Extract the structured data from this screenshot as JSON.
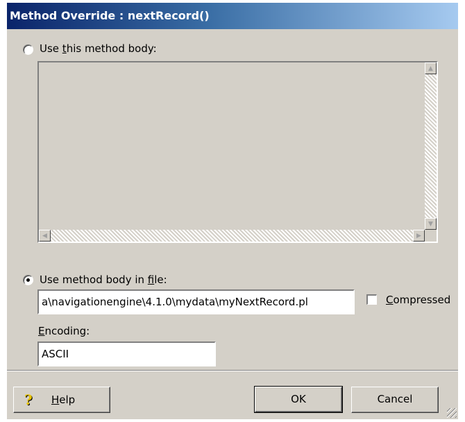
{
  "window": {
    "title": "Method Override : nextRecord()"
  },
  "option_body": {
    "label_pre": "Use ",
    "label_mnemonic": "t",
    "label_post": "his method body:",
    "selected": false
  },
  "option_file": {
    "label_pre": "Use method body in ",
    "label_mnemonic": "f",
    "label_post": "ile:",
    "selected": true,
    "path_value": "a\\navigationengine\\4.1.0\\mydata\\myNextRecord.pl"
  },
  "compressed": {
    "label_mnemonic": "C",
    "label_post": "ompressed",
    "checked": false
  },
  "encoding": {
    "label_mnemonic": "E",
    "label_post": "ncoding:",
    "value": "ASCII"
  },
  "buttons": {
    "help_mnemonic": "H",
    "help_post": "elp",
    "ok": "OK",
    "cancel": "Cancel"
  },
  "colors": {
    "dialog_bg": "#d4d0c8",
    "title_start": "#0a246a",
    "title_end": "#a6caf0"
  },
  "icons": [
    "help-icon",
    "scroll-up-icon",
    "scroll-down-icon",
    "scroll-left-icon",
    "scroll-right-icon",
    "size-grip-icon"
  ]
}
